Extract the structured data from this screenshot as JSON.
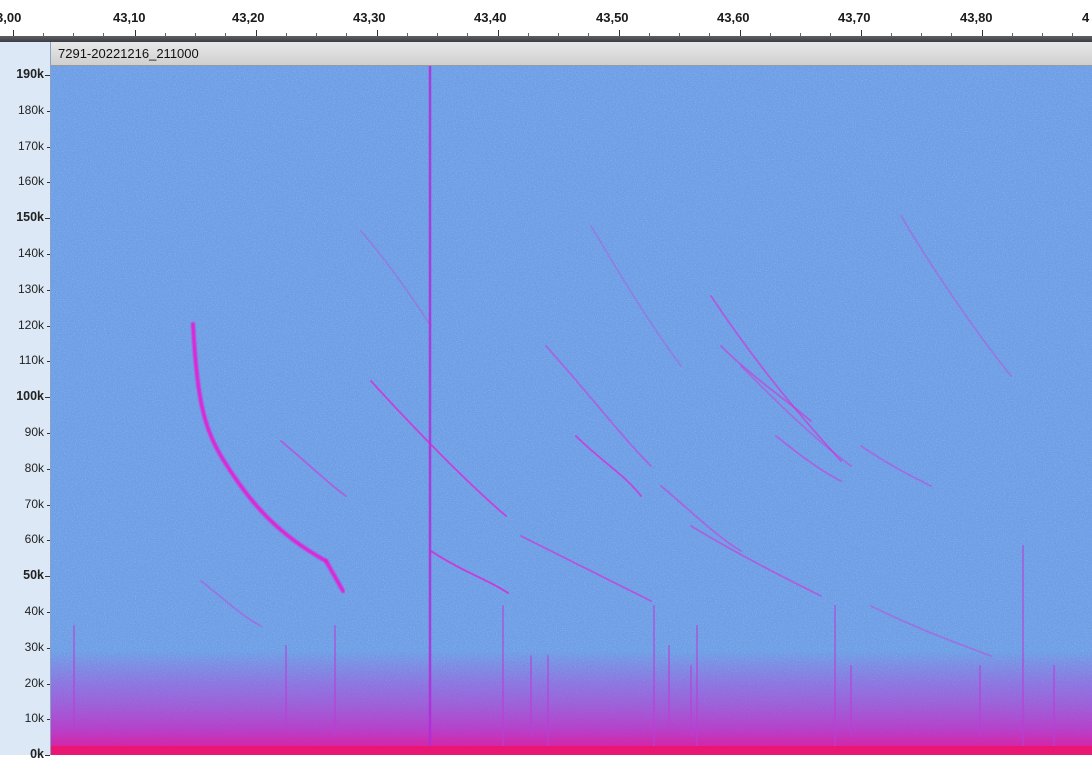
{
  "timeline": {
    "ticks": [
      "3,00",
      "43,10",
      "43,20",
      "43,30",
      "43,40",
      "43,50",
      "43,60",
      "43,70",
      "43,80",
      "4"
    ]
  },
  "track": {
    "name": "7291-20221216_211000"
  },
  "frequency_scale": {
    "labels": [
      "190k",
      "180k",
      "170k",
      "160k",
      "150k",
      "140k",
      "130k",
      "120k",
      "110k",
      "100k",
      "90k",
      "80k",
      "70k",
      "60k",
      "50k",
      "40k",
      "30k",
      "20k",
      "10k",
      "0k"
    ],
    "bold_labels": [
      "190k",
      "150k",
      "100k",
      "50k",
      "0k"
    ]
  },
  "colors": {
    "spectrogram_bg": "#6d9ee6",
    "signal": "#e021d6",
    "noise": "#d81ab6"
  }
}
